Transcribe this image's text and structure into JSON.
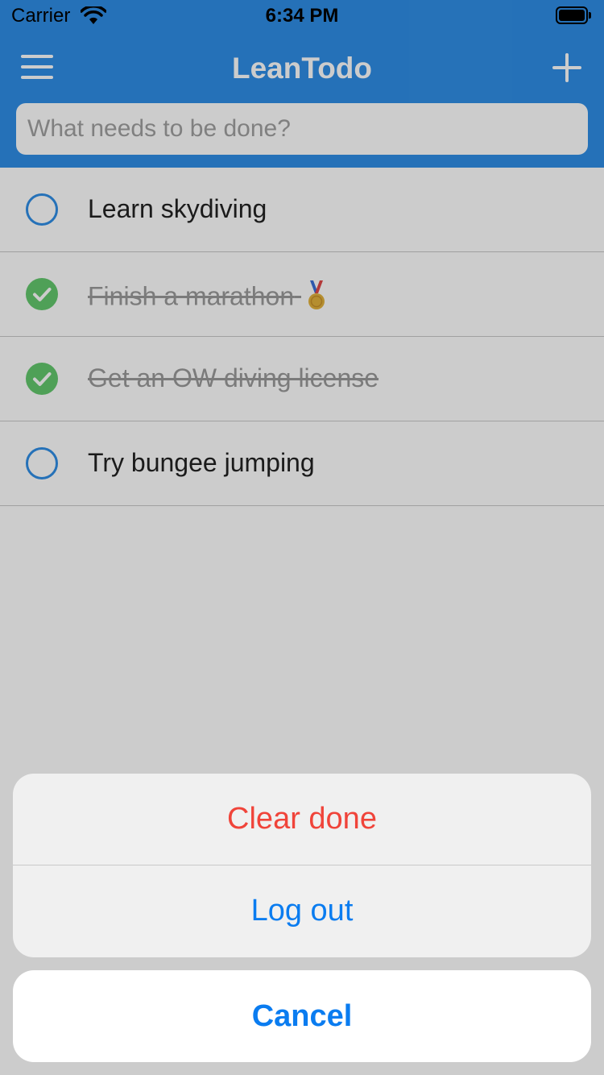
{
  "status_bar": {
    "carrier": "Carrier",
    "time": "6:34 PM"
  },
  "nav": {
    "title": "LeanTodo"
  },
  "search": {
    "placeholder": "What needs to be done?"
  },
  "todos": [
    {
      "text": "Learn skydiving",
      "done": false
    },
    {
      "text": "Finish a marathon",
      "done": true,
      "icon": "medal-icon"
    },
    {
      "text": "Get an OW diving license",
      "done": true
    },
    {
      "text": "Try bungee jumping",
      "done": false
    }
  ],
  "action_sheet": {
    "clear_done": "Clear done",
    "log_out": "Log out",
    "cancel": "Cancel"
  },
  "colors": {
    "accent": "#2f8ee6",
    "done_check": "#63c86d",
    "destructive": "#f0443a",
    "action_blue": "#0a7cf0"
  }
}
